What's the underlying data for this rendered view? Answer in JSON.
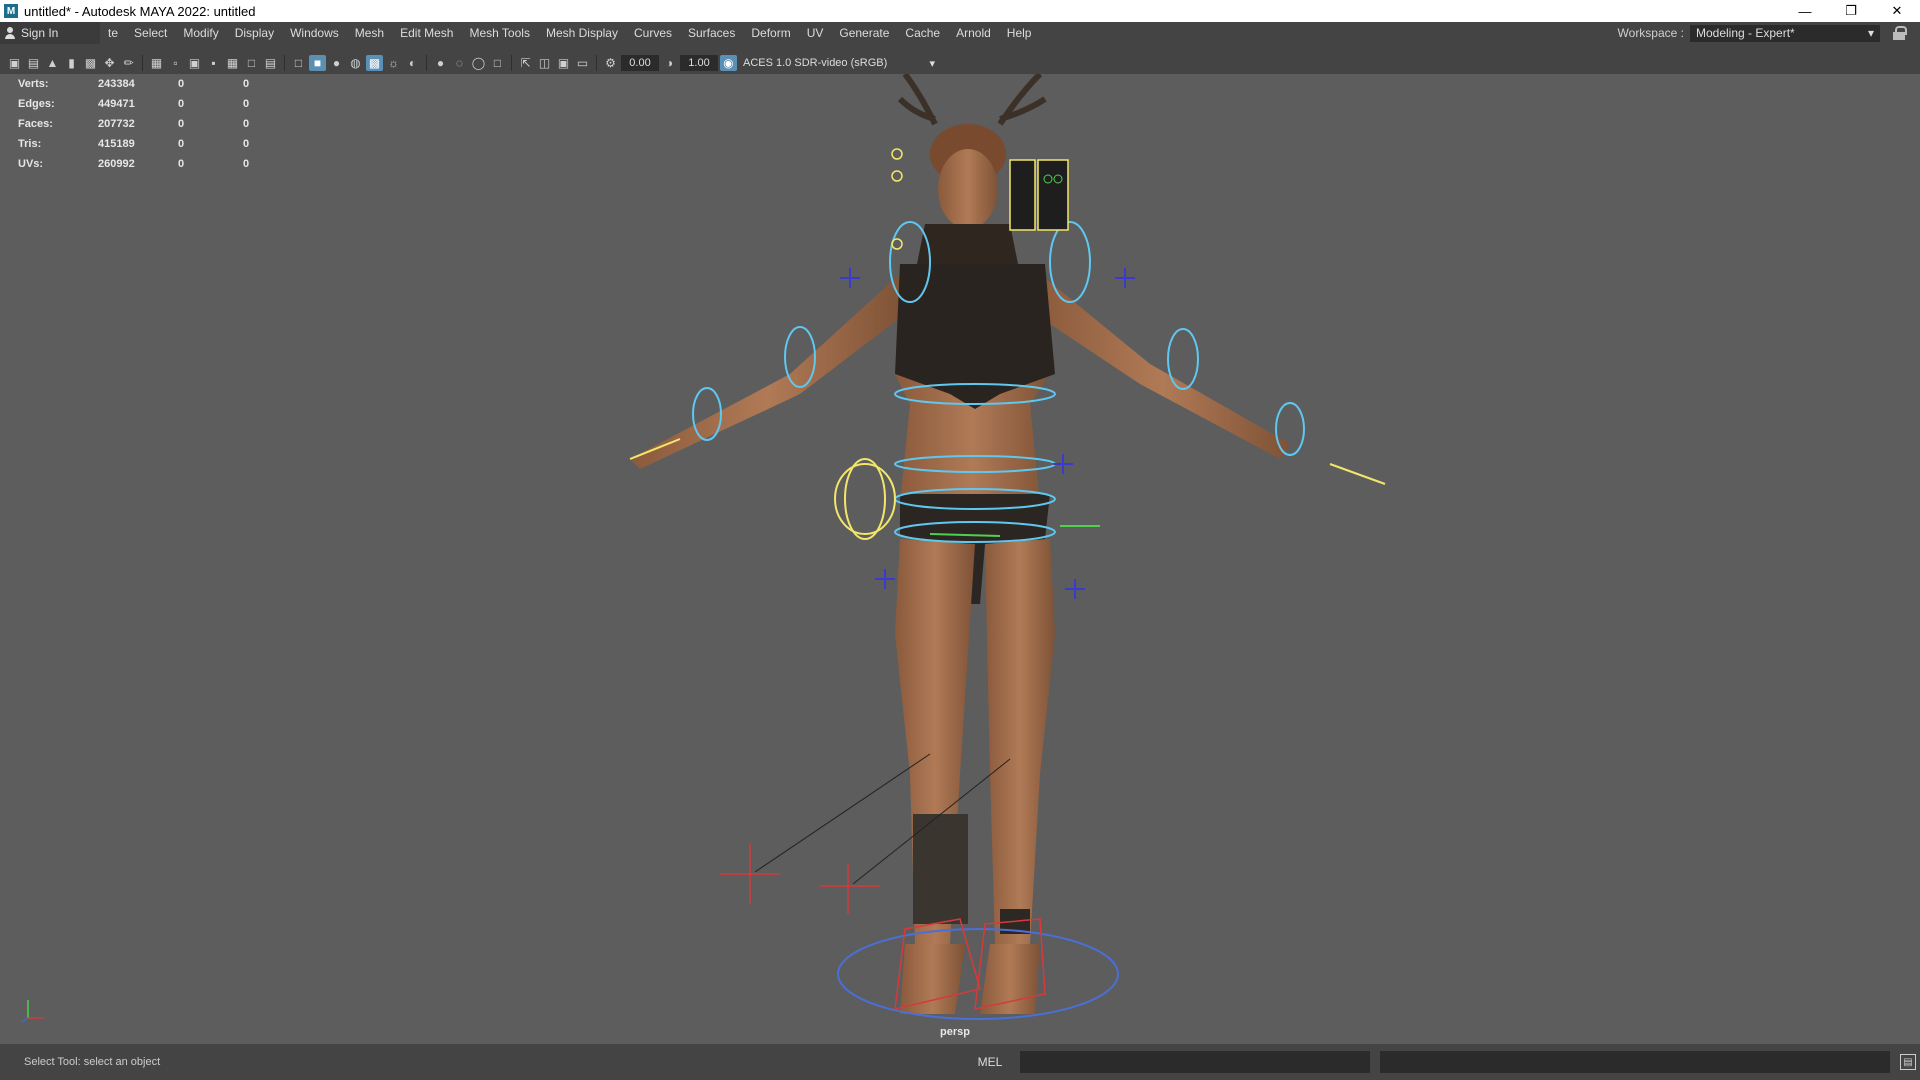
{
  "window": {
    "title": "untitled* - Autodesk MAYA 2022: untitled",
    "app_icon": "M"
  },
  "menubar": {
    "sign_in": "Sign In",
    "items": [
      "te",
      "Select",
      "Modify",
      "Display",
      "Windows",
      "Mesh",
      "Edit Mesh",
      "Mesh Tools",
      "Mesh Display",
      "Curves",
      "Surfaces",
      "Deform",
      "UV",
      "Generate",
      "Cache",
      "Arnold",
      "Help"
    ],
    "workspace_label": "Workspace :",
    "workspace_value": "Modeling - Expert*"
  },
  "toolbar": {
    "field1": "0.00",
    "field2": "1.00",
    "colorspace": "ACES 1.0 SDR-video (sRGB)"
  },
  "hud": {
    "rows": [
      {
        "label": "Verts:",
        "v1": "243384",
        "v2": "0",
        "v3": "0"
      },
      {
        "label": "Edges:",
        "v1": "449471",
        "v2": "0",
        "v3": "0"
      },
      {
        "label": "Faces:",
        "v1": "207732",
        "v2": "0",
        "v3": "0"
      },
      {
        "label": "Tris:",
        "v1": "415189",
        "v2": "0",
        "v3": "0"
      },
      {
        "label": "UVs:",
        "v1": "260992",
        "v2": "0",
        "v3": "0"
      }
    ]
  },
  "viewport": {
    "camera": "persp"
  },
  "statusbar": {
    "text": "Select Tool: select an object",
    "mel": "MEL"
  },
  "colors": {
    "viewport_bg": "#5d5d5d",
    "ui_bg": "#444444",
    "control_cyan": "#5ec8f0",
    "control_yellow": "#f2e66a",
    "control_red": "#d63a3a",
    "control_blue": "#3a3acc"
  }
}
